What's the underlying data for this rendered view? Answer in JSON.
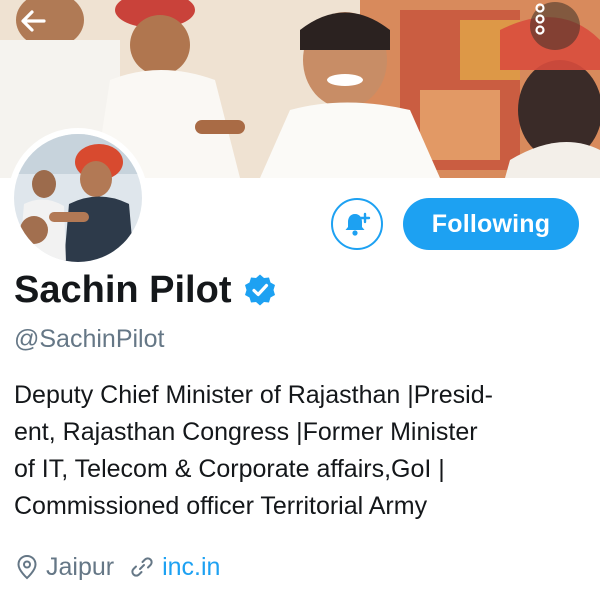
{
  "header": {
    "back_icon": "arrow-left-icon",
    "more_icon": "more-vertical-icon"
  },
  "profile": {
    "name": "Sachin Pilot",
    "handle": "@SachinPilot",
    "verified": true,
    "bio_lines": [
      "Deputy Chief Minister of Rajasthan |Presid-",
      "ent, Rajasthan Congress |Former Minister",
      "of IT, Telecom & Corporate affairs,GoI |",
      "Commissioned officer Territorial Army"
    ],
    "location": "Jaipur",
    "website": "inc.in"
  },
  "actions": {
    "notify_icon": "bell-plus-icon",
    "follow_label": "Following"
  },
  "colors": {
    "accent": "#1da1f2",
    "text_primary": "#14171a",
    "text_secondary": "#657786"
  }
}
